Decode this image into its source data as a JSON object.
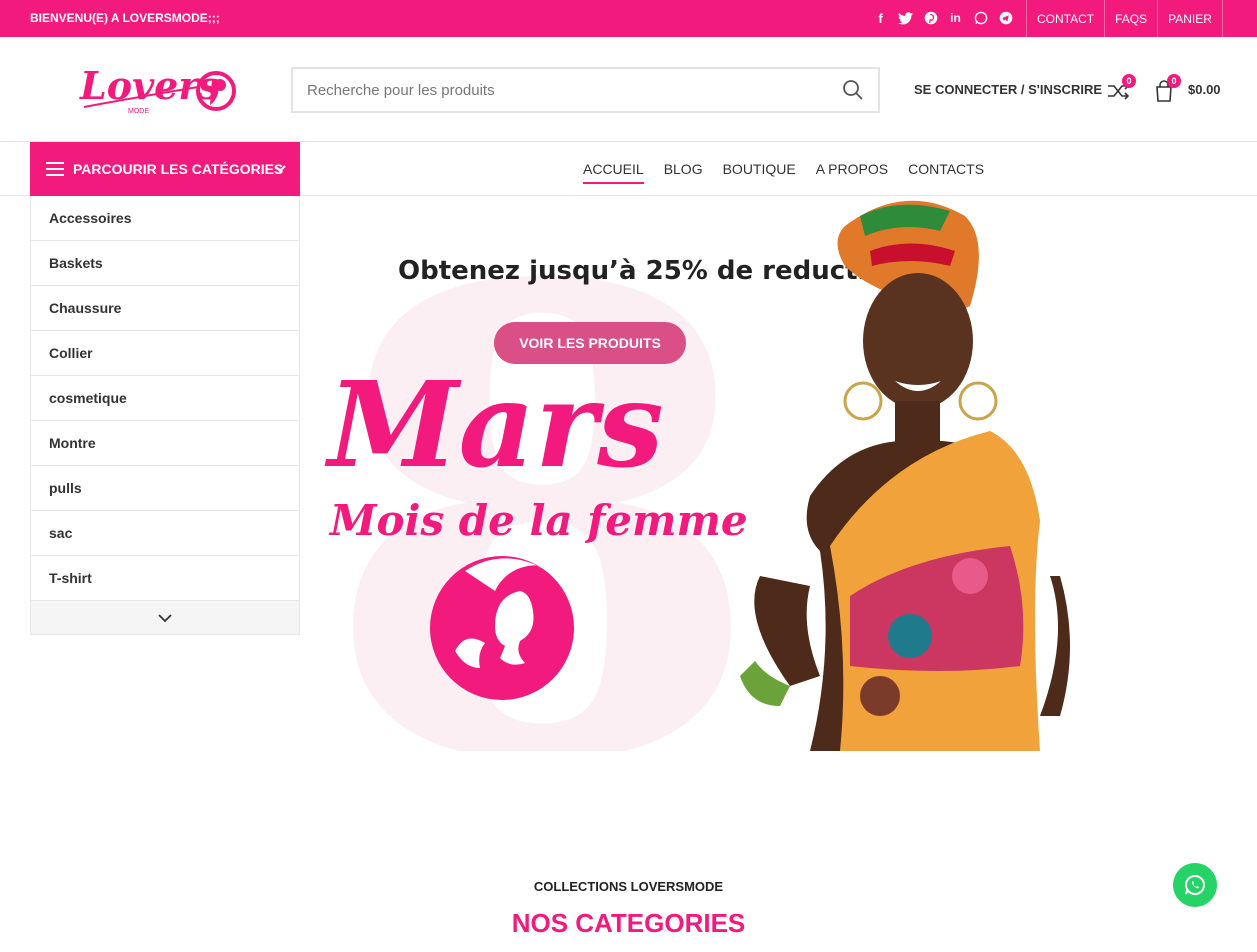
{
  "topbar": {
    "welcome": "BIENVENU(E) A LOVERSMODE;;;",
    "socials": [
      "facebook-icon",
      "twitter-icon",
      "pinterest-icon",
      "linkedin-icon",
      "whatsapp-icon",
      "telegram-icon"
    ],
    "links": [
      "CONTACT",
      "FAQS",
      "PANIER"
    ]
  },
  "header": {
    "logo_text": "Lovers",
    "logo_sub": "MODE",
    "search_placeholder": "Recherche pour les produits",
    "login": "SE CONNECTER / S'INSCRIRE",
    "compare_count": "0",
    "cart_count": "0",
    "cart_total": "$0.00"
  },
  "nav": {
    "categories_button": "PARCOURIR LES CATÉGORIES",
    "items": [
      "ACCUEIL",
      "BLOG",
      "BOUTIQUE",
      "A PROPOS",
      "CONTACTS"
    ]
  },
  "categories": [
    "Accessoires",
    "Baskets",
    "Chaussure",
    "Collier",
    "cosmetique",
    "Montre",
    "pulls",
    "sac",
    "T-shirt"
  ],
  "hero": {
    "promo": "Obtenez jusqu’à 25% de reduction",
    "cta": "VOIR LES PRODUITS",
    "title": "Mars",
    "subtitle": "Mois de la femme",
    "bg_numeral": "8"
  },
  "section": {
    "kicker": "COLLECTIONS LOVERSMODE",
    "title": "NOS CATEGORIES"
  },
  "colors": {
    "accent": "#f21a7d",
    "cta": "#d94f86",
    "whatsapp": "#25d366"
  }
}
